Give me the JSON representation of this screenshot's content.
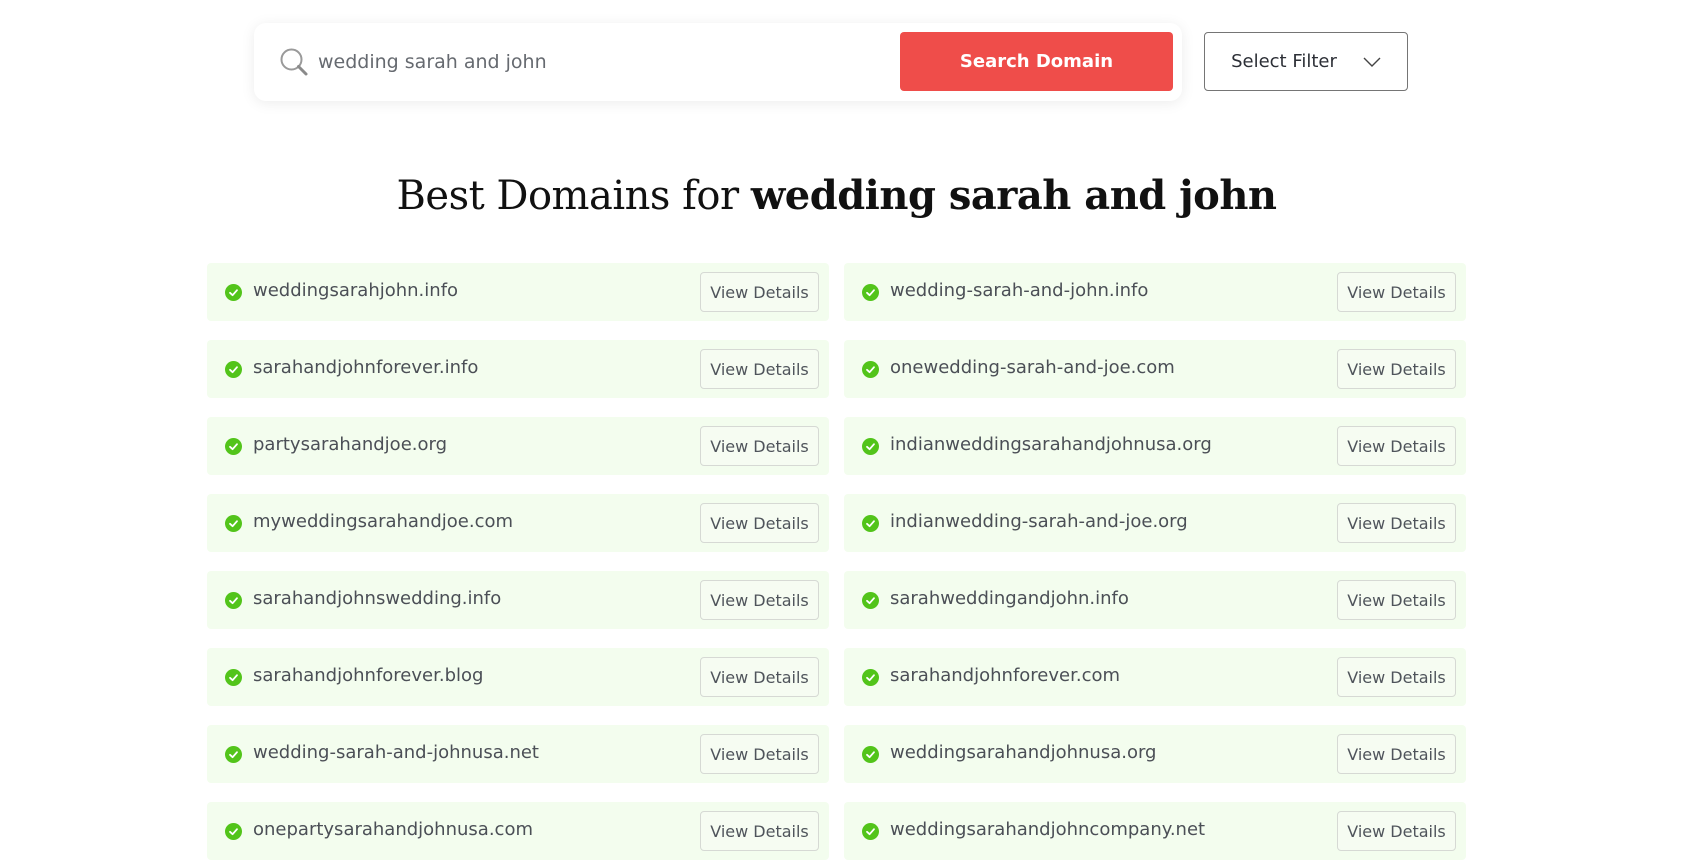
{
  "search": {
    "value": "wedding sarah and john",
    "icon": "search-icon",
    "button_label": "Search Domain",
    "button_color": "#ef4d4a"
  },
  "filter": {
    "label": "Select Filter",
    "icon": "chevron-down-icon"
  },
  "heading": {
    "prefix": "Best Domains for ",
    "query": "wedding sarah and john"
  },
  "results": {
    "status_icon": "check-circle-icon",
    "status_color": "#52c41a",
    "card_background": "#f3fdee",
    "view_label": "View Details",
    "items": [
      {
        "domain": "weddingsarahjohn.info"
      },
      {
        "domain": "wedding-sarah-and-john.info"
      },
      {
        "domain": "sarahandjohnforever.info"
      },
      {
        "domain": "onewedding-sarah-and-joe.com"
      },
      {
        "domain": "partysarahandjoe.org"
      },
      {
        "domain": "indianweddingsarahandjohnusa.org"
      },
      {
        "domain": "myweddingsarahandjoe.com"
      },
      {
        "domain": "indianwedding-sarah-and-joe.org"
      },
      {
        "domain": "sarahandjohnswedding.info"
      },
      {
        "domain": "sarahweddingandjohn.info"
      },
      {
        "domain": "sarahandjohnforever.blog"
      },
      {
        "domain": "sarahandjohnforever.com"
      },
      {
        "domain": "wedding-sarah-and-johnusa.net"
      },
      {
        "domain": "weddingsarahandjohnusa.org"
      },
      {
        "domain": "onepartysarahandjohnusa.com"
      },
      {
        "domain": "weddingsarahandjohncompany.net"
      }
    ]
  }
}
